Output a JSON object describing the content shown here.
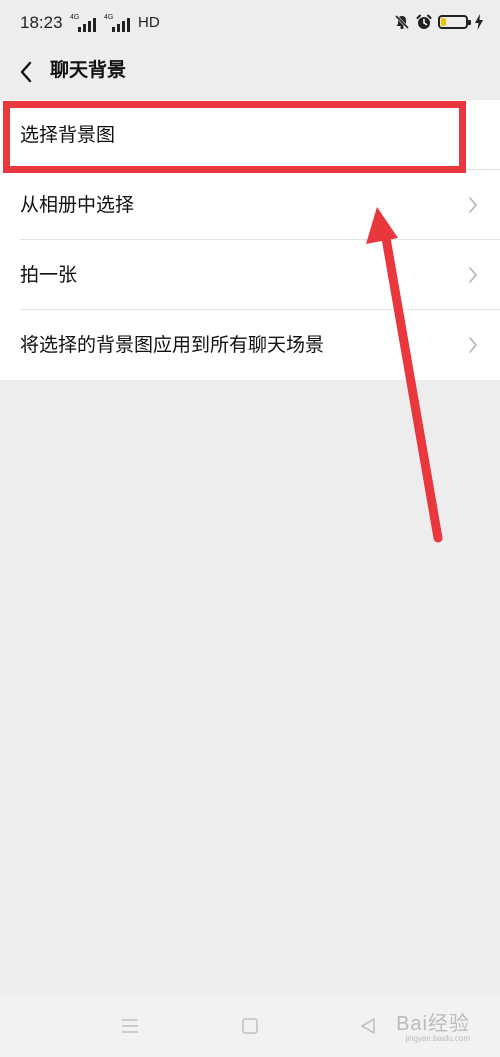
{
  "status_bar": {
    "time": "18:23",
    "sim1_tag": "4G",
    "sim2_tag": "4G",
    "network_label": "HD",
    "icons": [
      "mute-icon",
      "alarm-icon",
      "battery-icon",
      "charging-icon"
    ],
    "battery_color": "#f2c200"
  },
  "header": {
    "title": "聊天背景",
    "back_icon": "chevron-left-icon"
  },
  "menu": {
    "items": [
      {
        "label": "选择背景图",
        "has_chevron": false
      },
      {
        "label": "从相册中选择",
        "has_chevron": true
      },
      {
        "label": "拍一张",
        "has_chevron": true
      },
      {
        "label": "将选择的背景图应用到所有聊天场景",
        "has_chevron": true
      }
    ]
  },
  "annotation": {
    "color": "#e8383d",
    "highlight_target": "选择背景图"
  },
  "system_nav": {
    "buttons": [
      "menu-icon",
      "home-icon",
      "back-icon"
    ]
  },
  "watermark": {
    "text": "Bai经验",
    "sub": "jingyan.baidu.com"
  }
}
